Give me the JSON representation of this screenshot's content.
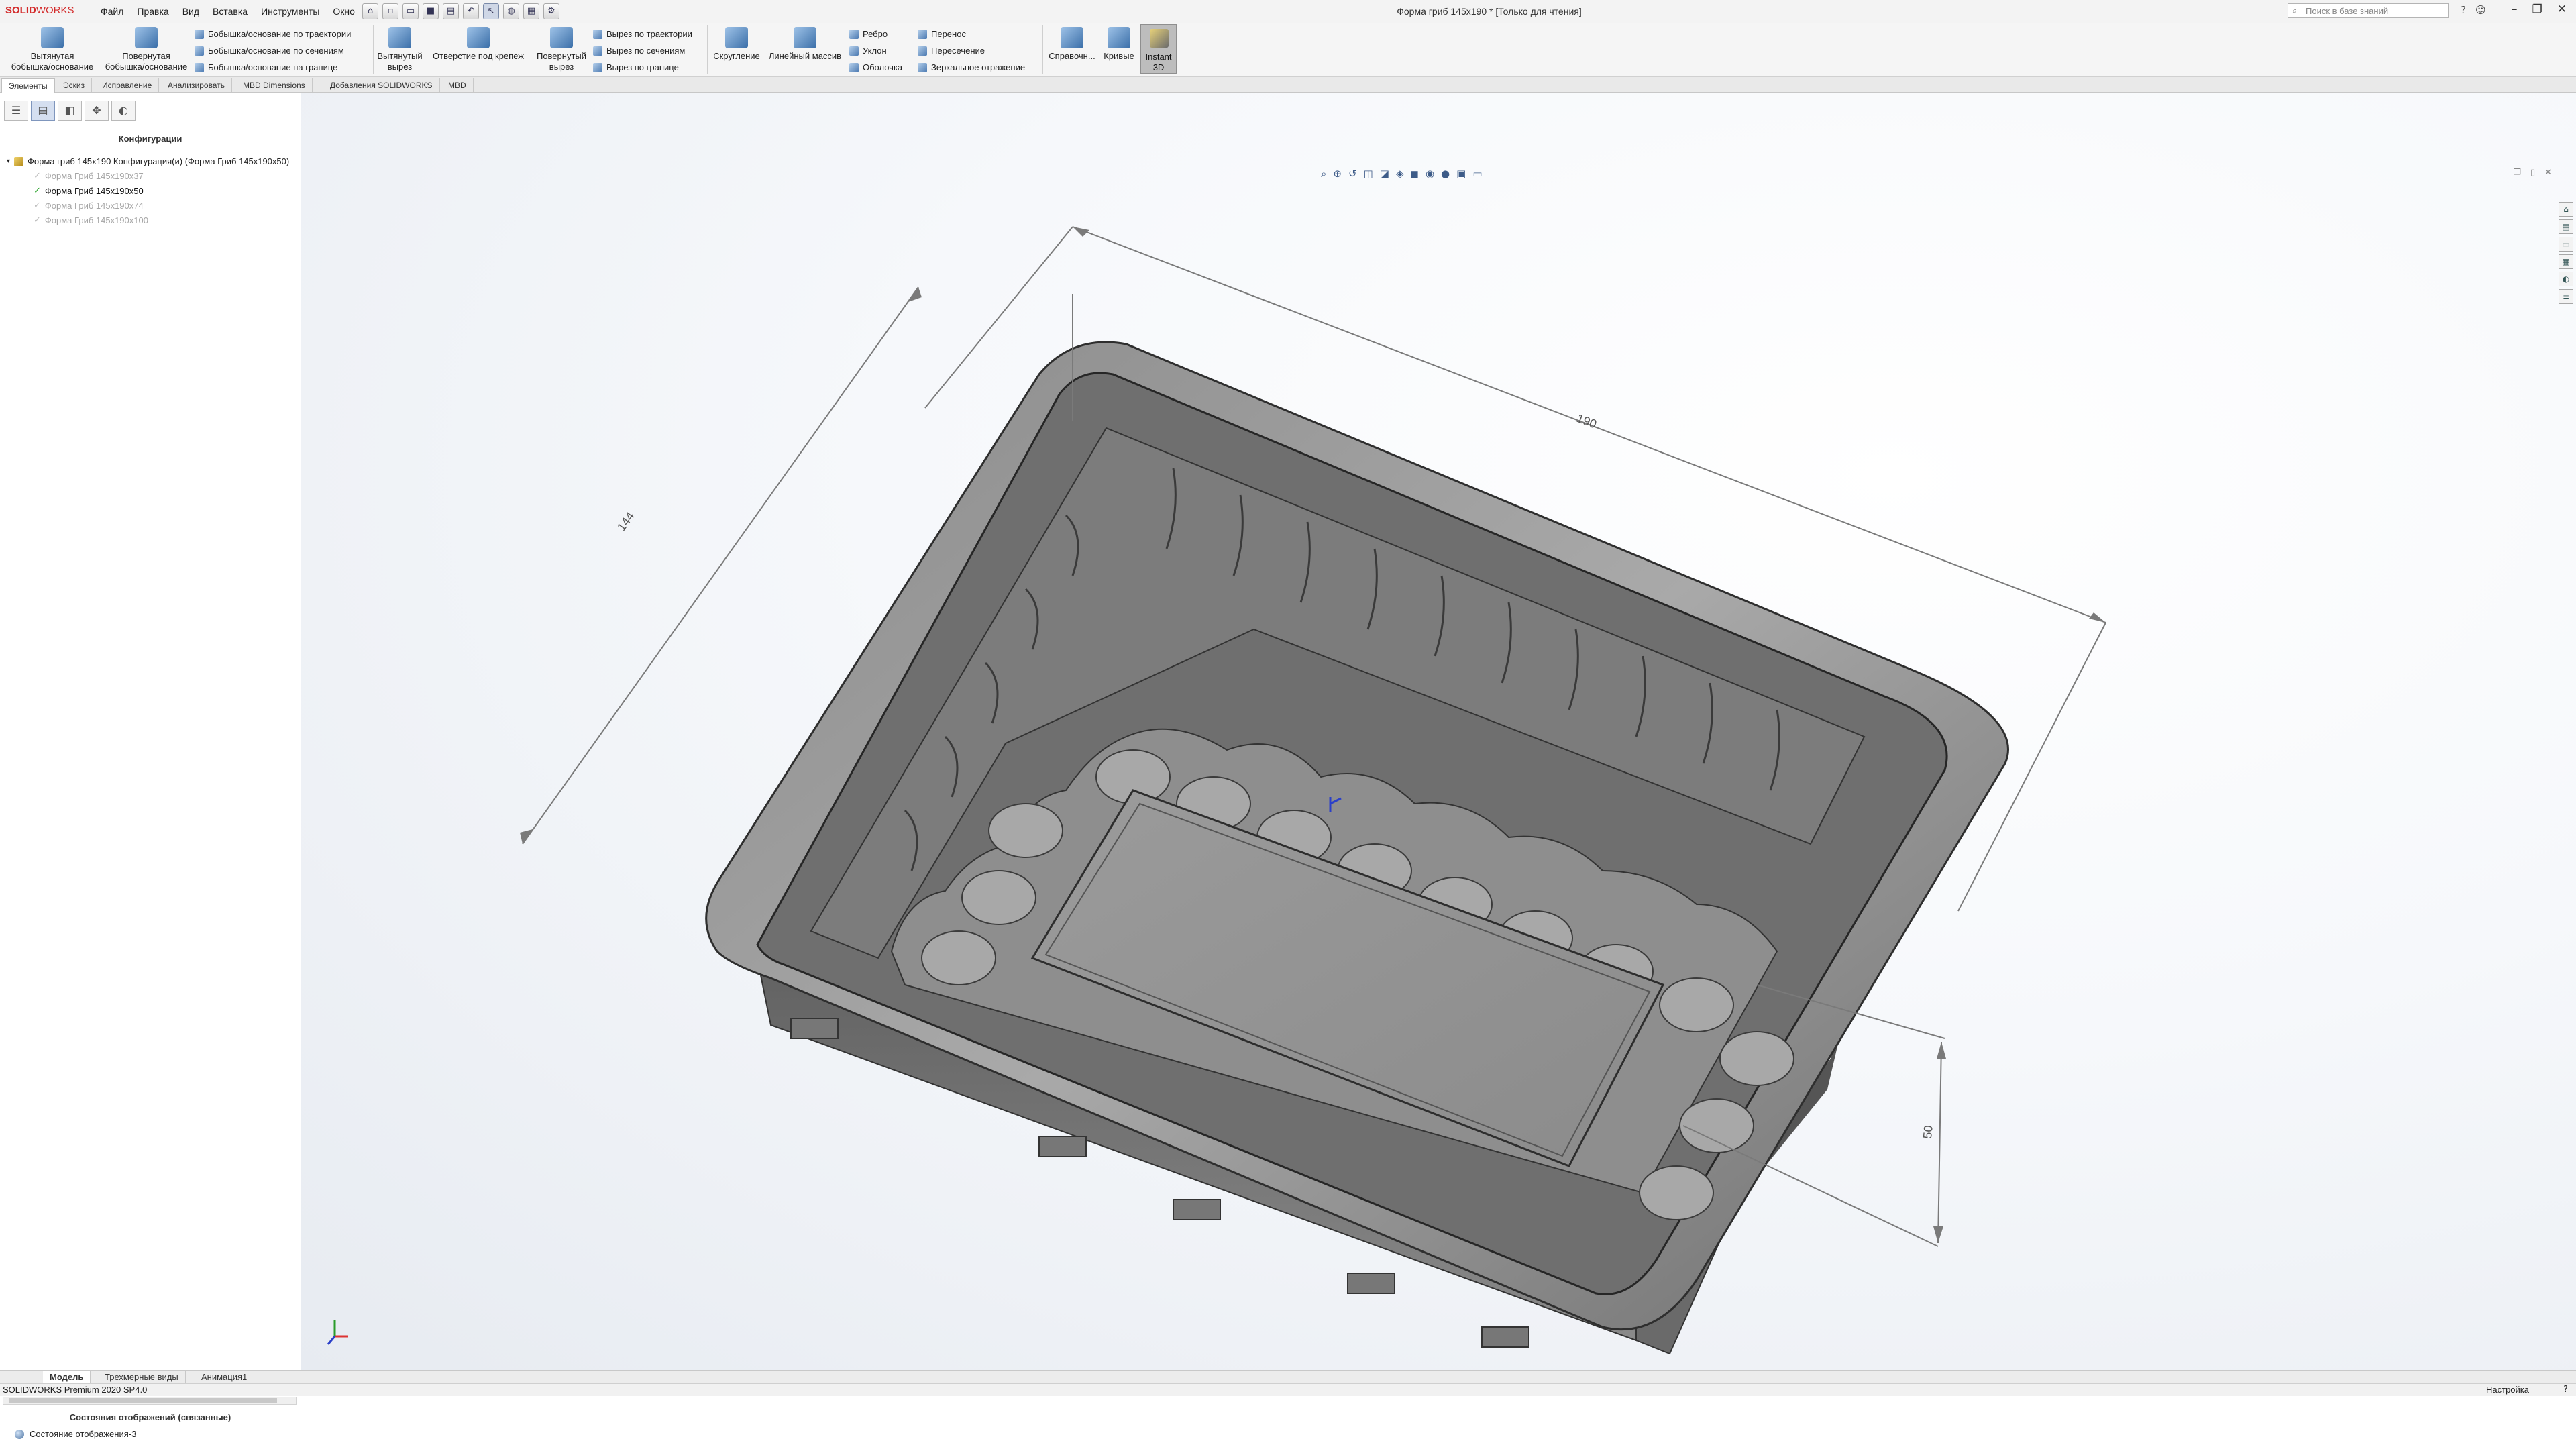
{
  "app": {
    "brand_left": "SOLID",
    "brand_right": "WORKS"
  },
  "menu": [
    "Файл",
    "Правка",
    "Вид",
    "Вставка",
    "Инструменты",
    "Окно"
  ],
  "window": {
    "title": "Форма гриб 145х190 * [Только для чтения]"
  },
  "search": {
    "placeholder": "Поиск в базе знаний"
  },
  "ribbon": {
    "extruded_boss_l1": "Вытянутая",
    "extruded_boss_l2": "бобышка/основание",
    "revolved_boss_l1": "Повернутая",
    "revolved_boss_l2": "бобышка/основание",
    "swept_boss": "Бобышка/основание по траектории",
    "lofted_boss": "Бобышка/основание по сечениям",
    "boundary_boss": "Бобышка/основание на границе",
    "extruded_cut_l1": "Вытянутый",
    "extruded_cut_l2": "вырез",
    "hole_wizard": "Отверстие под крепеж",
    "revolved_cut_l1": "Повернутый",
    "revolved_cut_l2": "вырез",
    "swept_cut": "Вырез по траектории",
    "lofted_cut": "Вырез по сечениям",
    "boundary_cut": "Вырез по границе",
    "fillet": "Скругление",
    "linear_pattern": "Линейный массив",
    "rib": "Ребро",
    "draft": "Уклон",
    "shell": "Оболочка",
    "wrap": "Перенос",
    "intersect": "Пересечение",
    "mirror": "Зеркальное отражение",
    "reference": "Справочн...",
    "curves": "Кривые",
    "instant_l1": "Instant",
    "instant_l2": "3D"
  },
  "tabs": [
    "Элементы",
    "Эскиз",
    "Исправление",
    "Анализировать",
    "MBD Dimensions",
    "Добавления SOLIDWORKS",
    "MBD"
  ],
  "left_pane": {
    "header": "Конфигурации",
    "tree_root": "Форма гриб 145х190 Конфигурация(и)  (Форма Гриб 145х190х50)",
    "configs": [
      {
        "label": "Форма Гриб 145х190х37",
        "active": false
      },
      {
        "label": "Форма Гриб 145х190х50",
        "active": true
      },
      {
        "label": "Форма Гриб 145х190х74",
        "active": false
      },
      {
        "label": "Форма Гриб 145х190х100",
        "active": false
      }
    ],
    "display_states_header": "Состояния отображений (связанные)",
    "display_state_item": "Состояние отображения-3"
  },
  "dimensions": {
    "length": "190",
    "width": "144",
    "height": "50"
  },
  "bottom_tabs": [
    "Модель",
    "Трехмерные виды",
    "Анимация1"
  ],
  "status": {
    "version": "SOLIDWORKS Premium 2020 SP4.0",
    "settings": "Настройка"
  }
}
